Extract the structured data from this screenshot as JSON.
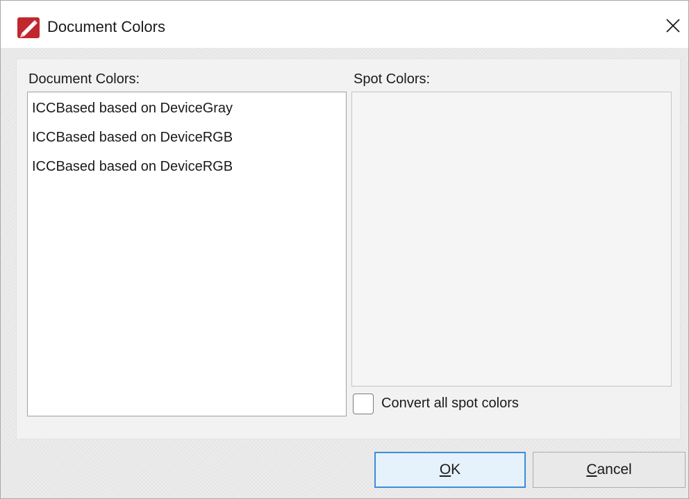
{
  "window": {
    "title": "Document Colors",
    "icon": "pdf-editor-app-icon",
    "close_icon": "close-icon",
    "accent_color": "#c0282d"
  },
  "document_colors": {
    "label": "Document Colors:",
    "items": [
      "ICCBased based on DeviceGray",
      "ICCBased based on DeviceRGB",
      "ICCBased based on DeviceRGB"
    ]
  },
  "spot_colors": {
    "label": "Spot Colors:",
    "items": [],
    "convert_checkbox_label": "Convert all spot colors",
    "convert_checked": false
  },
  "buttons": {
    "ok_mnemonic": "O",
    "ok_rest": "K",
    "cancel_mnemonic": "C",
    "cancel_rest": "ancel",
    "default_border_color": "#3b8ddd"
  }
}
